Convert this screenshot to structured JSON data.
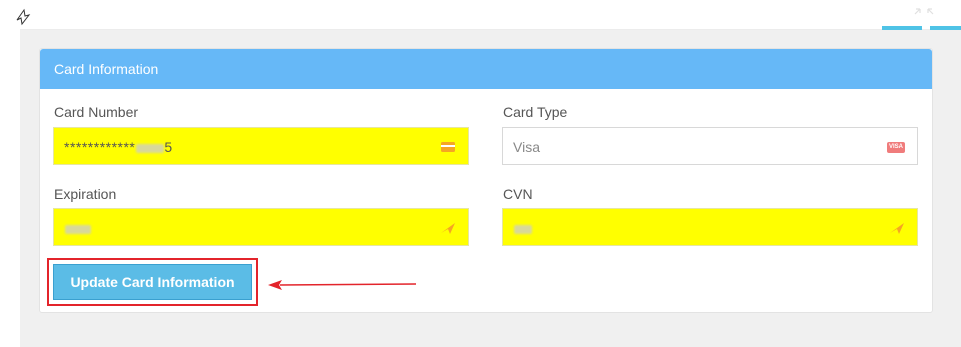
{
  "panel": {
    "title": "Card Information"
  },
  "fields": {
    "card_number": {
      "label": "Card Number",
      "value": "************",
      "value_suffix_visible": "5",
      "icon": "credit-card-icon"
    },
    "card_type": {
      "label": "Card Type",
      "value": "Visa",
      "icon": "visa-badge-icon",
      "icon_text": "VISA"
    },
    "expiration": {
      "label": "Expiration",
      "icon": "autofill-arrow-icon"
    },
    "cvn": {
      "label": "CVN",
      "icon": "autofill-arrow-icon"
    }
  },
  "actions": {
    "update_label": "Update Card Information"
  },
  "colors": {
    "header_blue": "#66b8f7",
    "button_blue": "#5bbce6",
    "highlight_yellow": "#ffff00",
    "annotation_red": "#e3242b"
  }
}
